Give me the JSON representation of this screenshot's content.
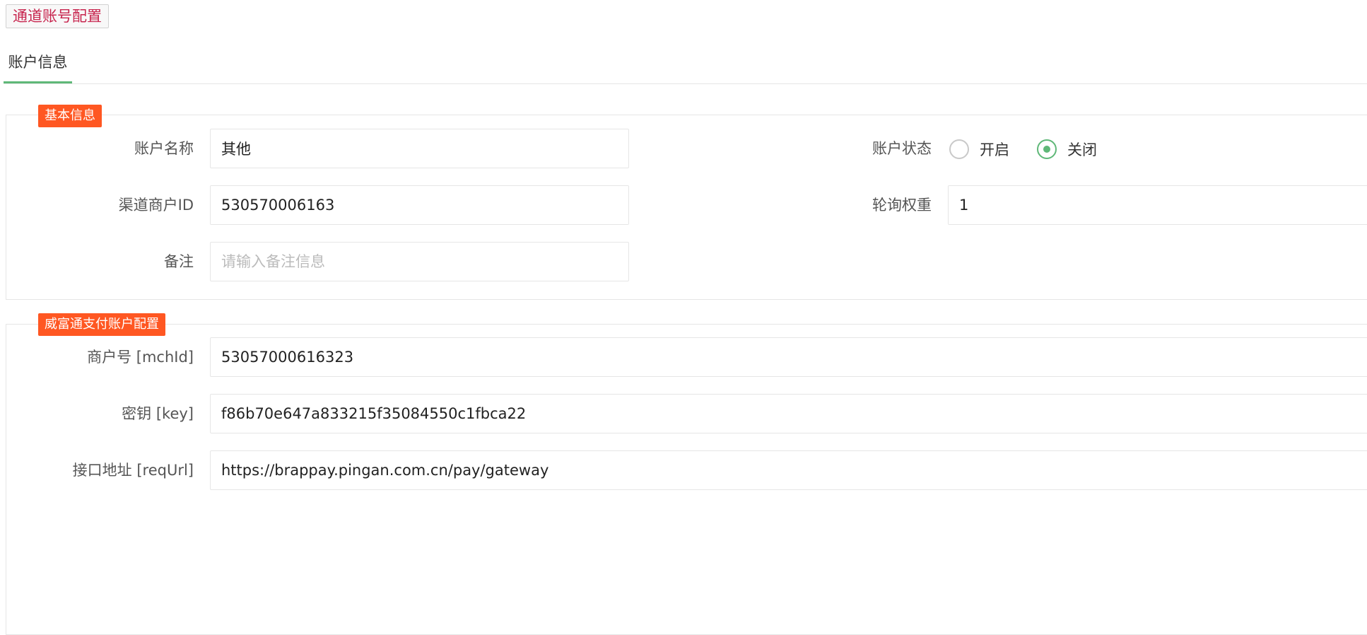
{
  "page": {
    "title": "通道账号配置"
  },
  "tabs": [
    {
      "label": "账户信息",
      "active": true
    }
  ],
  "basic_section": {
    "legend": "基本信息",
    "account_name": {
      "label": "账户名称",
      "value": "其他"
    },
    "account_status": {
      "label": "账户状态",
      "options": [
        {
          "label": "开启",
          "checked": false
        },
        {
          "label": "关闭",
          "checked": true
        }
      ]
    },
    "merchant_id": {
      "label": "渠道商户ID",
      "value": "530570006163"
    },
    "poll_weight": {
      "label": "轮询权重",
      "value": "1"
    },
    "remark": {
      "label": "备注",
      "value": "",
      "placeholder": "请输入备注信息"
    }
  },
  "payment_section": {
    "legend": "威富通支付账户配置",
    "mch_id": {
      "label": "商户号 [mchId]",
      "value": "53057000616323"
    },
    "key": {
      "label": "密钥 [key]",
      "value": "f86b70e647a833215f35084550c1fbca22"
    },
    "req_url": {
      "label": "接口地址 [reqUrl]",
      "value": "https://brappay.pingan.com.cn/pay/gateway"
    }
  },
  "colors": {
    "accent": "#5fb878",
    "legend_bg": "#ff5722",
    "title_text": "#c7254e"
  }
}
